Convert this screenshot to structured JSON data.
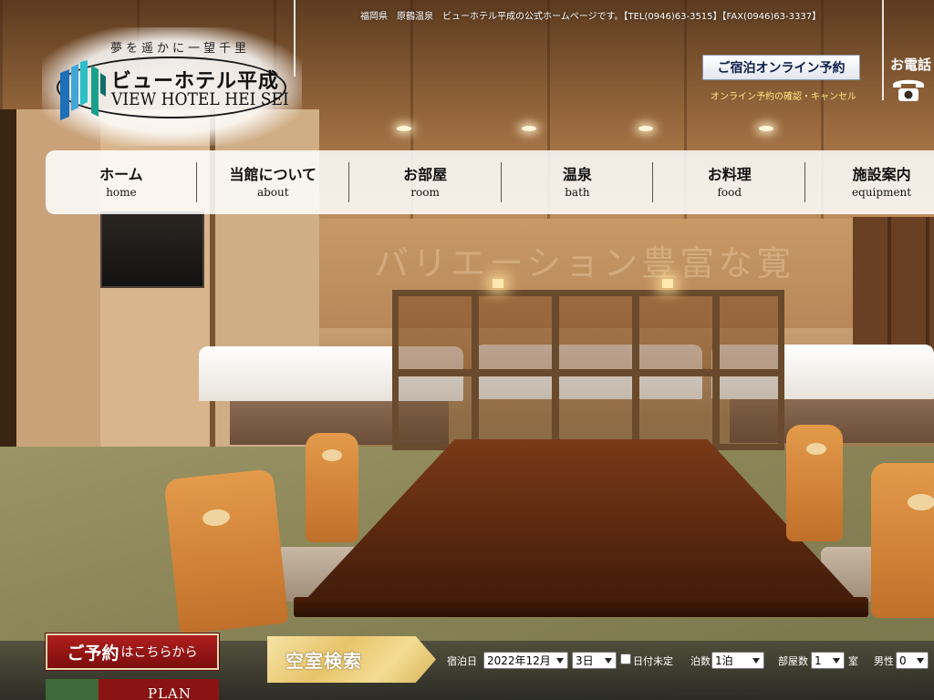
{
  "header": {
    "top_text": "福岡県　原鶴温泉　ビューホテル平成の公式ホームページです。【TEL(0946)63-3515】【FAX(0946)63-3337】",
    "logo": {
      "tagline": "夢を遥かに一望千里",
      "name_jp": "ビューホテル平成",
      "name_en": "VIEW HOTEL HEI SEI"
    },
    "online_booking_button": "ご宿泊オンライン予約",
    "online_booking_confirm_link": "オンライン予約の確認・キャンセル",
    "phone_title": "お電話"
  },
  "hero": {
    "watermark_text": "バリエーション豊富な寛"
  },
  "nav": {
    "items": [
      {
        "jp": "ホーム",
        "en": "home"
      },
      {
        "jp": "当館について",
        "en": "about"
      },
      {
        "jp": "お部屋",
        "en": "room"
      },
      {
        "jp": "温泉",
        "en": "bath"
      },
      {
        "jp": "お料理",
        "en": "food"
      },
      {
        "jp": "施設案内",
        "en": "equipment"
      }
    ]
  },
  "reservation": {
    "reserve_button_main": "ご予約",
    "reserve_button_sub": "はこちらから",
    "plan_button": "PLAN",
    "vacancy_label": "空室検索",
    "checkin_label": "宿泊日",
    "month_value": "2022年12月",
    "day_value": "3日",
    "undecided_label": "日付未定",
    "nights_label": "泊数",
    "nights_value": "1泊",
    "rooms_label": "部屋数",
    "rooms_value": "1",
    "rooms_unit": "室",
    "male_label": "男性",
    "male_value": "0"
  },
  "colors": {
    "nav_bg": "#ffffff",
    "reserve_red": "#9a1818",
    "vacancy_gold": "#e7c46a",
    "confirm_link": "#ffe680"
  }
}
